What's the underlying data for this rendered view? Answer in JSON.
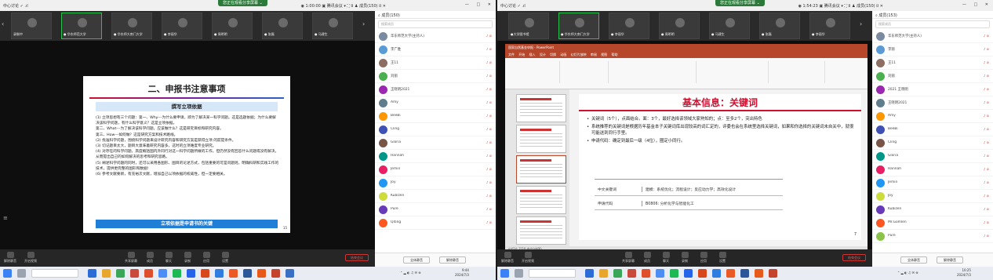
{
  "left": {
    "titlebar": {
      "left_text": "中心讨论  ✓  .ıl",
      "share_label": "您正在观看分享屏幕 ⌄",
      "right_text": "◉ 1:00:00   ▣ 腾讯会议 ▾   ⛶ ⌷  ♟ 成员(150)  ⌷ ✕",
      "window_controls": "— □ ✕"
    },
    "video_tiles": [
      "录制中",
      "● 华东师范大学",
      "● 华东师大南门大学",
      "● 李丽华",
      "● 周明明",
      "● 张磊",
      "● 马建生"
    ],
    "slide": {
      "title": "二、申报书注意事项",
      "subtitle": "撰写立项依据",
      "paragraphs": [
        "(1) 立项思想有三个问题：第一、Why---为什么要申请，即为了解决某一科学问题。这是选题依据；为什么要解决该科学问题，有什么科学意义？这是立项依据。",
        "第二、What---为了解决该科学问题，应该做什么？这是研究目标和研究内容。",
        "第三、How---如何做？这是研究方案和技术路线。",
        "(2) 找准科学问题，围绕科学问题来设计研究内容和研究方案是获得立项 的前提条件。",
        "(3) 切记题目太大，题目大意味着研究内容多，这时的立项难度专业研究。",
        "(4) 对存在的科学问题，高度概括国内外同行对这一科学问题所做的工作，但仍然没有回答什么问题或没有解决，从而提出自己的如何解决的思考和研究思路。",
        "(5) 阐述科学问题的同时，还可以采用各图形、图目的论述方式，包括重要的可是问题则，明确科研和实践工作的技术，提供更完整的图形和数据!",
        "(6) 参考文献要新，有充裕次文献，增加自己以项依据的权威性，但一定要相关。"
      ],
      "footer": "立项依据是申请书的关键",
      "page_number": "15"
    },
    "participants_header": "⌕ 成员(150)",
    "participants_search": "搜索成员",
    "participants": [
      "华东师范大学(主持人)",
      "李广胜",
      "王11",
      "刘丽",
      "王晓明2021",
      "Amy",
      "BeeBi",
      "Cling",
      "Gloria",
      "Hannah",
      "Jemin",
      "Joy",
      "Kubizen",
      "Pure",
      "Qiting"
    ],
    "participant_footer": [
      "全体静音",
      "解除静音"
    ],
    "bottom_buttons": [
      "解除静音",
      "开启视频",
      "共享屏幕",
      "成员",
      "聊天",
      "录制",
      "应用",
      "设置"
    ],
    "end_button": "结束会议",
    "clock": {
      "time": "9:44",
      "date": "2024/7/3"
    }
  },
  "right": {
    "titlebar": {
      "left_text": "中心讨论  ✓  .ıl",
      "share_label": "您正在观看分享屏幕 ⌄",
      "right_text": "◉ 1:54:23   ▣ 腾讯会议 ▾   ⛶ ⌷  ♟ 成员(150)  ⌷ ✕",
      "window_controls": "— □ ✕"
    },
    "video_tiles": [
      "●大学图书馆",
      "● 华东师大南门大学",
      "● 李丽华",
      "● 周明明",
      "● 马建生",
      "● 张磊",
      "● 李丽华"
    ],
    "ppt_title": "国家自然基金申报 - PowerPoint",
    "ppt_tabs": "文件 开始 插入 设计 切换 动画 幻灯片放映 审阅 视图 帮助",
    "slide": {
      "title": "基本信息：关键词",
      "bullets": [
        "关键词（5个），点面结合。面：3个，最好选择该领域大家熟知的；点：至多2个，突出特色",
        "系统推荐的关键词是根据历年基金本子关键词库出现较高的词汇定的，评委也会在系统里选择关键词，如果和你选择的关键词未自关中，就很可能送到同行手里。",
        "申请代码：确定到最后一级（4位），圈定小同行。"
      ],
      "table": [
        {
          "label": "中文关键词",
          "value": "建模：系统优化；流程设计；反应动力学；高效化设计"
        },
        {
          "label": "申请代码",
          "value": "B0806: 分析化学与智能化工"
        }
      ],
      "page_number": "7"
    },
    "status_bar": "幻灯片 7/20  中文(中国)",
    "participants_header": "⌕ 成员(153)",
    "participants_search": "搜索成员",
    "participants": [
      "华东师范大学(主持人)",
      "李丽",
      "王11",
      "刘丽",
      "2021 王晓明",
      "王晓明2021",
      "Amy",
      "BeeBi",
      "Cling",
      "Gloria",
      "Hannah",
      "Jemin",
      "Joy",
      "Kubizen",
      "Mr.Gomlen",
      "Pure"
    ],
    "participant_footer": [
      "全体静音",
      "解除静音"
    ],
    "bottom_buttons": [
      "解除静音",
      "开启视频",
      "共享屏幕",
      "成员",
      "聊天",
      "录制",
      "应用",
      "设置"
    ],
    "end_button": "结束会议",
    "clock": {
      "time": "10:25",
      "date": "2024/7/3"
    }
  },
  "colors": {
    "accent_red": "#c0392b",
    "ppt_red": "#b7472a",
    "slide_title_red": "#d10f2f",
    "meeting_green": "#27c14b"
  }
}
